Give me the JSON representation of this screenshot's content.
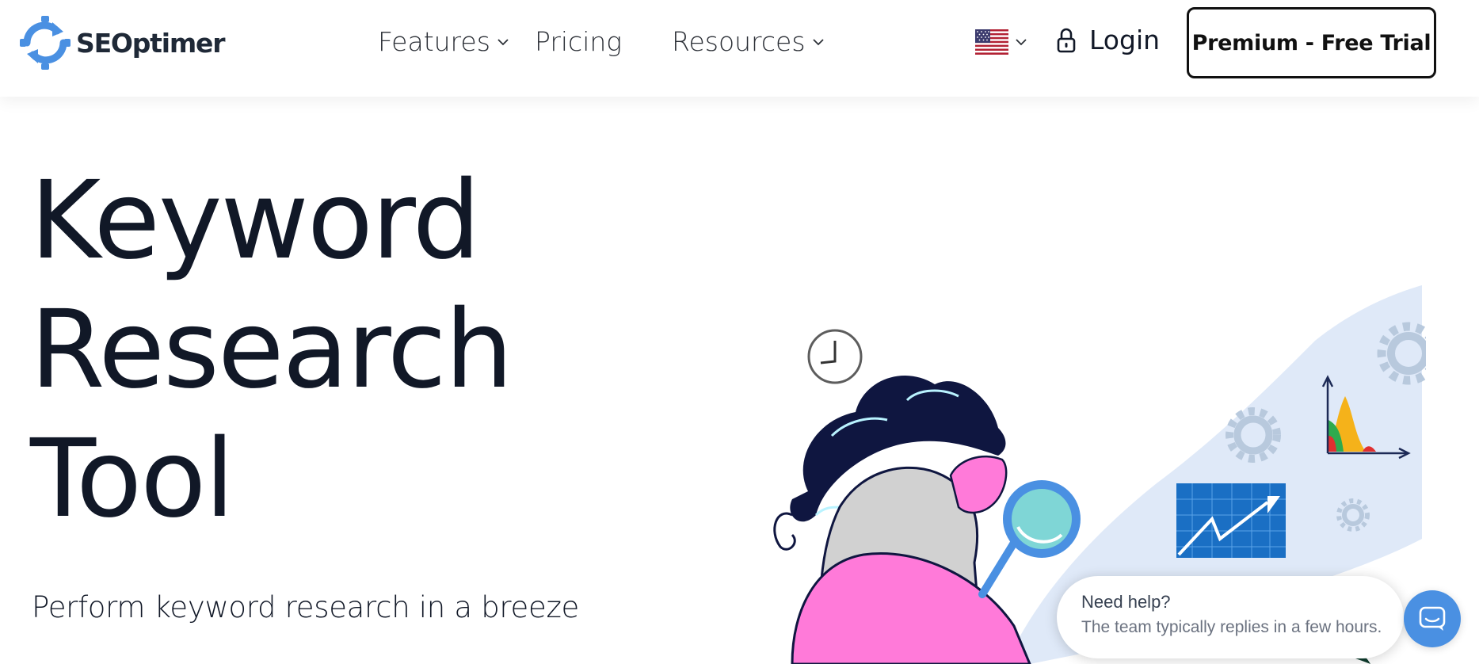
{
  "brand": {
    "name": "SEOptimer",
    "logo_icon": "refresh-gear-logo-icon",
    "accent": "#4a90e2"
  },
  "nav": {
    "items": [
      {
        "label": "Features",
        "has_dropdown": true,
        "icon": "chevron-down-icon"
      },
      {
        "label": "Pricing",
        "has_dropdown": false
      },
      {
        "label": "Resources",
        "has_dropdown": true,
        "icon": "chevron-down-icon"
      }
    ],
    "language": {
      "icon": "us-flag-icon",
      "has_dropdown": true
    },
    "login": {
      "label": "Login",
      "icon": "lock-icon"
    },
    "cta": {
      "label": "Premium - Free Trial"
    }
  },
  "hero": {
    "title_lines": [
      "Keyword",
      "Research",
      "Tool"
    ],
    "highlight_color": "#fde9a8",
    "subtitle": "Perform keyword research in a breeze"
  },
  "illustration": {
    "icons": [
      "clock-icon",
      "gear-icon",
      "bar-chart-icon",
      "trend-chart-icon",
      "magnifier-icon"
    ],
    "colors": {
      "blob": "#dfe9f8",
      "hair": "#0f1640",
      "skin": "#ff7ad9",
      "shirt": "#d1d1d1",
      "lens": "#7fd6d6",
      "chart_panel": "#1a6fc4"
    }
  },
  "chat": {
    "title": "Need help?",
    "text": "The team typically replies in a few hours.",
    "launcher_icon": "chat-icon",
    "launcher_color": "#4a90e2"
  }
}
